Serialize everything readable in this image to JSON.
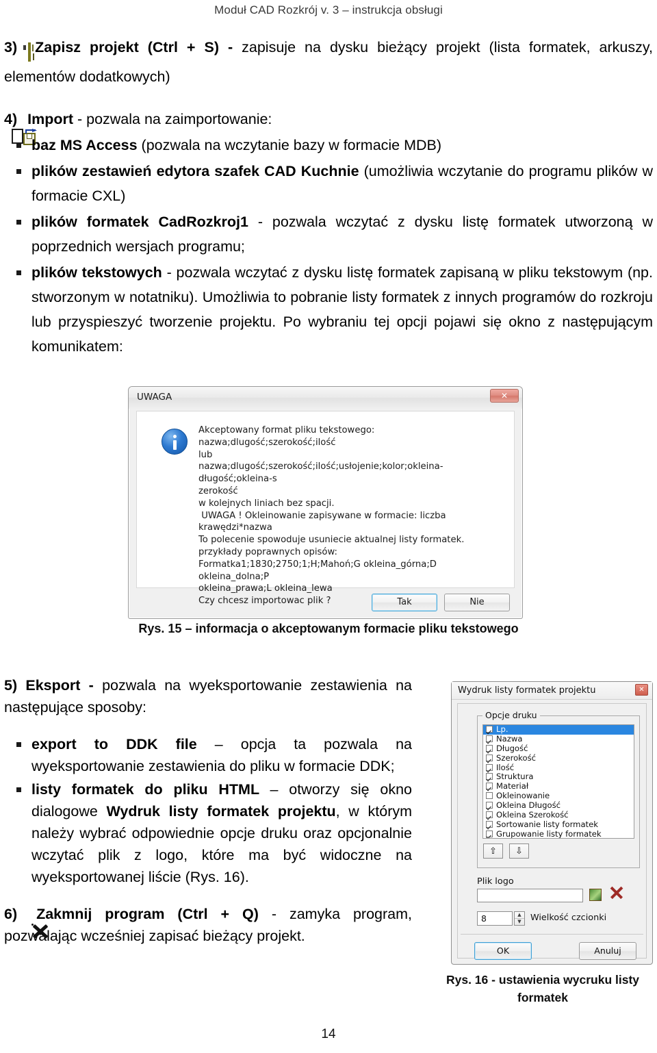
{
  "header": {
    "title": "Moduł CAD Rozkrój v. 3 – instrukcja obsługi"
  },
  "page": {
    "number": "14"
  },
  "sections": {
    "item3": {
      "num": "3)",
      "icon": "save-floppy-icon",
      "bold": "Zapisz projekt (Ctrl + S) -",
      "text": " zapisuje na dysku bieżący projekt (lista formatek, arkuszy, elementów dodatkowych)"
    },
    "item4": {
      "num": "4)",
      "icon": "import-icon",
      "bold": "Import",
      "text": " - pozwala na zaimportowanie:"
    },
    "item5": {
      "num": "5) Eksport - ",
      "text": "pozwala na wyeksportowanie zestawienia na następujące sposoby:"
    },
    "item6": {
      "num": "6)",
      "icon": "close-x-icon",
      "bold": "Zakmnij program (Ctrl + Q)",
      "text": " - zamyka program, pozwalając wcześniej zapisać bieżący projekt."
    }
  },
  "bullets_import": [
    {
      "bold": "baz MS Access ",
      "rest": "(pozwala na wczytanie bazy w formacie MDB)"
    },
    {
      "bold": "plików zestawień edytora szafek CAD Kuchnie ",
      "rest": "(umożliwia wczytanie do programu plików w formacie CXL)"
    },
    {
      "bold": "plików formatek CadRozkroj1 ",
      "rest": "- pozwala wczytać z dysku listę formatek utworzoną w poprzednich wersjach programu;"
    },
    {
      "bold": "plików tekstowych ",
      "rest": "- pozwala wczytać z dysku listę formatek zapisaną w pliku tekstowym (np. stworzonym w notatniku). Umożliwia to pobranie listy formatek z innych programów do rozkroju lub przyspieszyć tworzenie projektu. Po wybraniu tej opcji pojawi się okno z następującym komunikatem:"
    }
  ],
  "bullets_export": [
    {
      "bold": "export to DDK file ",
      "rest": "– opcja ta pozwala na wyeksportowanie zestawienia do pliku w formacie DDK;"
    },
    {
      "bold": "listy formatek do pliku HTML ",
      "rest": "– otworzy się okno dialogowe ",
      "bold2": "Wydruk listy formatek projektu",
      "rest2": ", w którym należy wybrać odpowiednie opcje druku oraz opcjonalnie wczytać plik z logo, które ma być widoczne na wyeksportowanej liście (Rys. 16)."
    }
  ],
  "dialog_uwaga": {
    "title": "UWAGA",
    "close_label": "✕",
    "icon": "info-icon",
    "message": "Akceptowany format pliku tekstowego:\nnazwa;dlugość;szerokość;ilość\nlub\nnazwa;dlugość;szerokość;ilość;usłojenie;kolor;okleina-długość;okleina-s\nzerokość\nw kolejnych liniach bez spacji.\n UWAGA ! Okleinowanie zapisywane w formacie: liczba krawędzi*nazwa\nTo polecenie spowoduje usuniecie aktualnej listy formatek.\nprzykłady poprawnych opisów:\nFormatka1;1830;2750;1;H;Mahoń;G okleina_górna;D okleina_dolna;P\nokleina_prawa;L okleina_lewa\nCzy chcesz importowac plik ?",
    "btn_yes": "Tak",
    "btn_no": "Nie"
  },
  "caption15": "Rys. 15 – informacja o  akceptowanym formacie  pliku tekstowego",
  "dialog_wydruk": {
    "title": "Wydruk listy formatek projektu",
    "close_label": "✕",
    "group_label": "Opcje druku",
    "options": [
      {
        "label": "Lp.",
        "checked": true,
        "selected": true
      },
      {
        "label": "Nazwa",
        "checked": true,
        "selected": false
      },
      {
        "label": "Długość",
        "checked": true,
        "selected": false
      },
      {
        "label": "Szerokość",
        "checked": true,
        "selected": false
      },
      {
        "label": "Ilość",
        "checked": true,
        "selected": false
      },
      {
        "label": "Struktura",
        "checked": true,
        "selected": false
      },
      {
        "label": "Materiał",
        "checked": true,
        "selected": false
      },
      {
        "label": "Okleinowanie",
        "checked": false,
        "selected": false
      },
      {
        "label": "Okleina Długość",
        "checked": true,
        "selected": false
      },
      {
        "label": "Okleina Szerokość",
        "checked": true,
        "selected": false
      },
      {
        "label": "Sortowanie listy formatek",
        "checked": true,
        "selected": false
      },
      {
        "label": "Grupowanie listy formatek",
        "checked": true,
        "selected": false
      }
    ],
    "move_up": "⇧",
    "move_down": "⇩",
    "logo_label": "Plik logo",
    "logo_value": "",
    "font_size_value": "8",
    "font_size_label": "Wielkość czcionki",
    "spin_up": "▲",
    "spin_down": "▼",
    "btn_ok": "OK",
    "btn_cancel": "Anuluj"
  },
  "caption16": "Rys. 16 - ustawienia wycruku listy formatek"
}
